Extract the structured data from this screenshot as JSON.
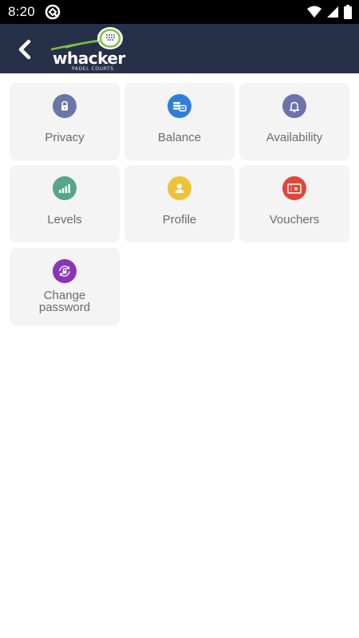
{
  "status_bar": {
    "time": "8:20",
    "icons": [
      "app-notification-icon",
      "wifi-icon",
      "cellular-signal-icon",
      "battery-icon"
    ]
  },
  "header": {
    "back_icon": "chevron-left-icon",
    "logo_word": "whacker",
    "logo_sub": "PADEL COURTS",
    "background": "#263049",
    "accent": "#7dc142"
  },
  "menu": {
    "items": [
      {
        "label": "Privacy",
        "icon": "lock-icon",
        "color": "#6b75a8"
      },
      {
        "label": "Balance",
        "icon": "coins-icon",
        "color": "#2f7fd6"
      },
      {
        "label": "Availability",
        "icon": "bell-icon",
        "color": "#6f72aa"
      },
      {
        "label": "Levels",
        "icon": "signal-bars-icon",
        "color": "#57a58a"
      },
      {
        "label": "Profile",
        "icon": "person-icon",
        "color": "#f0c23a"
      },
      {
        "label": "Vouchers",
        "icon": "ticket-icon",
        "color": "#e2453a"
      },
      {
        "label": "Change password",
        "label_line1": "Change",
        "label_line2": "password",
        "icon": "lock-refresh-icon",
        "color": "#8a35b8"
      }
    ]
  }
}
